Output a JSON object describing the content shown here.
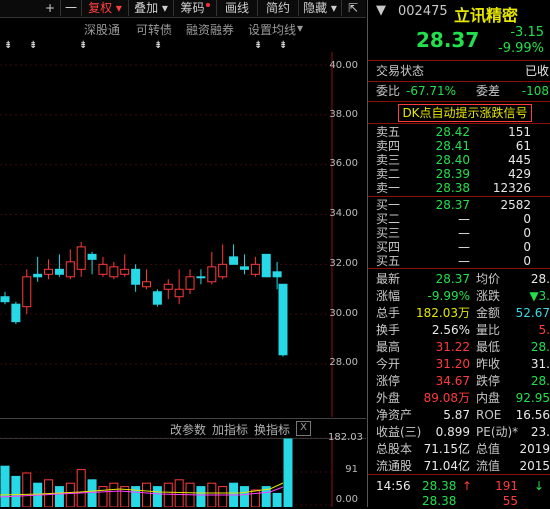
{
  "toolbar": {
    "plus": "+",
    "minus": "一",
    "fuquan": "复权",
    "diejia": "叠加",
    "chouma": "筹码",
    "huaxian": "画线",
    "jianyue": "简约",
    "yincang": "隐藏",
    "expand": "⇱",
    "dropdown": "▾"
  },
  "menu": {
    "shengutong": "深股通",
    "kezhuanzhai": "可转债",
    "rongzirongquan": "融资融券",
    "shezhi_junxian": "设置均线",
    "dropdown": "▾",
    "marker": "⇟"
  },
  "price_axis": [
    "40.00",
    "38.00",
    "36.00",
    "34.00",
    "32.00",
    "30.00",
    "28.00"
  ],
  "volume_axis": [
    "182.03",
    "91",
    "0.00"
  ],
  "subbar": {
    "gai_canshu": "改参数",
    "jia_zhibiao": "加指标",
    "huan_zhibiao": "换指标",
    "close": "X"
  },
  "stock": {
    "code": "002475",
    "name": "立讯精密",
    "price": "28.37",
    "change": "-3.15",
    "change_pct": "-9.99%",
    "status_label": "交易状态",
    "status_value": "已收",
    "weibi_label": "委比",
    "weibi_value": "-67.71%",
    "weicha_label": "委差",
    "weicha_value": "-108",
    "signal_banner": "DK点自动提示涨跌信号"
  },
  "asks": [
    {
      "label": "卖五",
      "price": "28.42",
      "vol": "151"
    },
    {
      "label": "卖四",
      "price": "28.41",
      "vol": "61"
    },
    {
      "label": "卖三",
      "price": "28.40",
      "vol": "445"
    },
    {
      "label": "卖二",
      "price": "28.39",
      "vol": "429"
    },
    {
      "label": "卖一",
      "price": "28.38",
      "vol": "12326"
    }
  ],
  "bids": [
    {
      "label": "买一",
      "price": "28.37",
      "vol": "2582"
    },
    {
      "label": "买二",
      "price": "—",
      "vol": "0"
    },
    {
      "label": "买三",
      "price": "—",
      "vol": "0"
    },
    {
      "label": "买四",
      "price": "—",
      "vol": "0"
    },
    {
      "label": "买五",
      "price": "—",
      "vol": "0"
    }
  ],
  "stats": [
    {
      "l1": "最新",
      "v1": "28.37",
      "c1": "green",
      "l2": "均价",
      "v2": "28.",
      "c2": "white"
    },
    {
      "l1": "涨幅",
      "v1": "-9.99%",
      "c1": "green",
      "l2": "涨跌",
      "v2": "▼3.",
      "c2": "green"
    },
    {
      "l1": "总手",
      "v1": "182.03万",
      "c1": "yellow",
      "l2": "金额",
      "v2": "52.67",
      "c2": "cyan"
    },
    {
      "l1": "换手",
      "v1": "2.56%",
      "c1": "white",
      "l2": "量比",
      "v2": "5.",
      "c2": "red"
    },
    {
      "l1": "最高",
      "v1": "31.22",
      "c1": "red",
      "l2": "最低",
      "v2": "28.",
      "c2": "green"
    },
    {
      "l1": "今开",
      "v1": "31.20",
      "c1": "red",
      "l2": "昨收",
      "v2": "31.",
      "c2": "white"
    },
    {
      "l1": "涨停",
      "v1": "34.67",
      "c1": "red",
      "l2": "跌停",
      "v2": "28.",
      "c2": "green"
    },
    {
      "l1": "外盘",
      "v1": "89.08万",
      "c1": "red",
      "l2": "内盘",
      "v2": "92.95",
      "c2": "green"
    },
    {
      "l1": "净资产",
      "v1": "5.87",
      "c1": "white",
      "l2": "ROE",
      "v2": "16.56",
      "c2": "white"
    },
    {
      "l1": "收益(三)",
      "v1": "0.899",
      "c1": "white",
      "l2": "PE(动)*",
      "v2": "23.",
      "c2": "white"
    },
    {
      "l1": "总股本",
      "v1": "71.15亿",
      "c1": "white",
      "l2": "总值",
      "v2": "2019",
      "c2": "white"
    },
    {
      "l1": "流通股",
      "v1": "71.04亿",
      "c1": "white",
      "l2": "流值",
      "v2": "2015",
      "c2": "white"
    }
  ],
  "ticks": [
    {
      "time": "14:56",
      "price": "28.38",
      "arrow": "↑",
      "vol": "191",
      "flag": "↓"
    },
    {
      "time": "",
      "price": "28.38",
      "arrow": "",
      "vol": "55",
      "flag": ""
    }
  ],
  "colors": {
    "up": "#ff3b3b",
    "down": "#22e04c",
    "volume_up": "#27d8e6"
  }
}
